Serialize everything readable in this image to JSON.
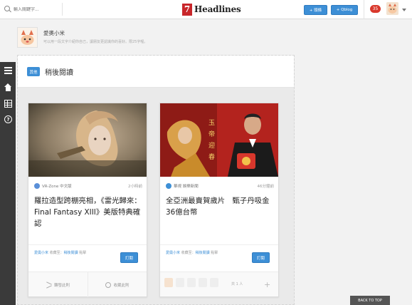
{
  "topbar": {
    "search_placeholder": "輸入關鍵字...",
    "logo_badge": "7",
    "logo_text": "Headlines",
    "btn_heading": "+ 頭條",
    "btn_qblog": "+ Qblog",
    "notifications": "35"
  },
  "profile": {
    "name": "愛奧小米",
    "hint": "可以用一段文字介紹你自己，讓朋友更認識你的喜好。限25字喔。"
  },
  "panel": {
    "tag": "其他",
    "title": "稍後閱讀"
  },
  "cards": [
    {
      "source": "VR-Zone 中文版",
      "time": "2小時前",
      "title": "羅拉造型跨棚亮相，《雷光歸來：Final Fantasy XIII》美版特典確認",
      "via_user": "愛奧小米",
      "via_mid": " 收藏至：",
      "via_list": "稍後閱讀",
      "via_end": " 點擊",
      "subscribe": "訂閱",
      "share": "轉發此則",
      "save": "收藏此則",
      "source_color": "#5a8fd8"
    },
    {
      "source": "華視 娛樂新聞",
      "time": "46分鐘前",
      "title": "全亞洲最賣賀歲片　甄子丹吸金36億台幣",
      "via_user": "愛奧小米",
      "via_mid": " 收藏至：",
      "via_list": "稍後閱讀",
      "via_end": " 點擊",
      "subscribe": "訂閱",
      "likes": "共 1 人",
      "source_color": "#3d8fd6"
    }
  ],
  "back_to_top": "BACK TO TOP",
  "colors": {
    "accent": "#3d8fd6",
    "logo_red": "#c8262a",
    "rail": "#3a3a3a",
    "badge_red": "#d9382c"
  }
}
